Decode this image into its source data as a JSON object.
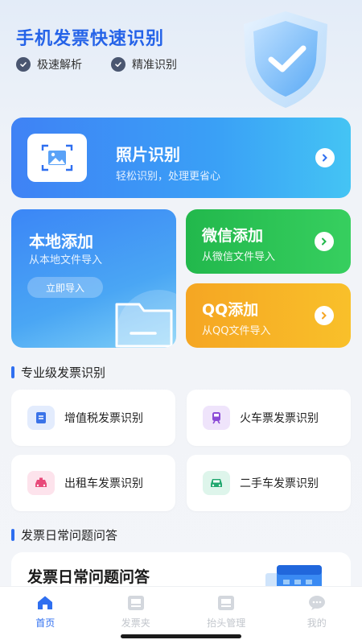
{
  "header": {
    "title": "手机发票快速识别",
    "features": [
      "极速解析",
      "精准识别"
    ]
  },
  "photo_card": {
    "title": "照片识别",
    "subtitle": "轻松识别，处理更省心"
  },
  "local_card": {
    "title": "本地添加",
    "subtitle": "从本地文件导入",
    "button": "立即导入"
  },
  "wechat_card": {
    "title": "微信添加",
    "subtitle": "从微信文件导入"
  },
  "qq_card": {
    "title": "QQ添加",
    "subtitle": "从QQ文件导入"
  },
  "pro_section": {
    "heading": "专业级发票识别",
    "items": [
      {
        "label": "增值税发票识别",
        "icon": "document-icon",
        "color": "#3a73e8"
      },
      {
        "label": "火车票发票识别",
        "icon": "train-icon",
        "color": "#8b4bd6"
      },
      {
        "label": "出租车发票识别",
        "icon": "taxi-icon",
        "color": "#e84a7a"
      },
      {
        "label": "二手车发票识别",
        "icon": "car-icon",
        "color": "#22a870"
      }
    ]
  },
  "faq_section": {
    "heading": "发票日常问题问答",
    "card_title": "发票日常问题问答"
  },
  "tabbar": {
    "tabs": [
      {
        "label": "首页",
        "icon": "home-icon",
        "active": true
      },
      {
        "label": "发票夹",
        "icon": "invoice-folder-icon",
        "active": false
      },
      {
        "label": "抬头管理",
        "icon": "header-manage-icon",
        "active": false
      },
      {
        "label": "我的",
        "icon": "chat-bubble-icon",
        "active": false
      }
    ]
  },
  "colors": {
    "brand": "#2563e8",
    "accent": "#2f6ff0",
    "wechat": "#22b84c",
    "qq": "#f5a623"
  }
}
